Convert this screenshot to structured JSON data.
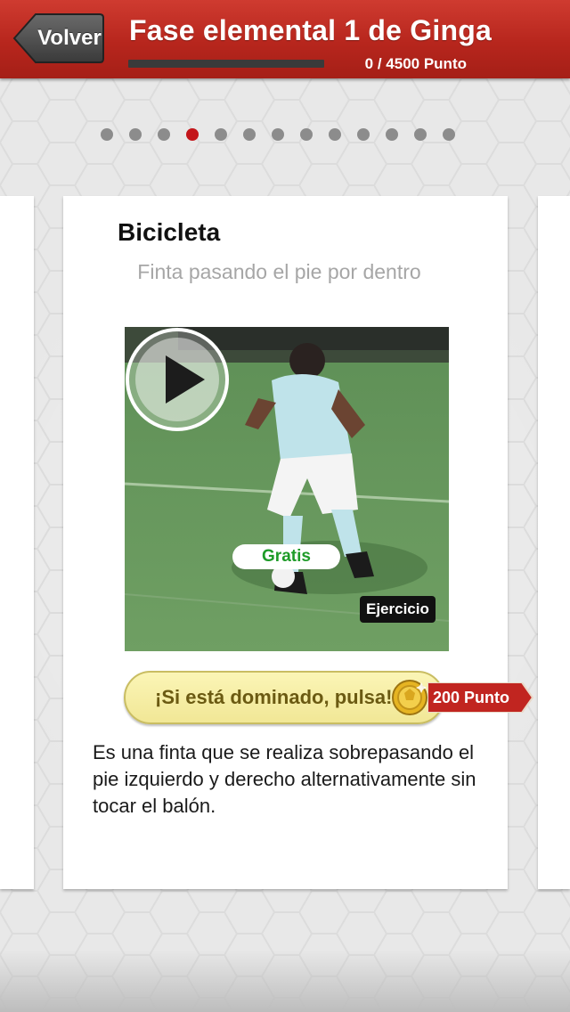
{
  "header": {
    "back_label": "Volver",
    "title": "Fase elemental 1 de Ginga",
    "points_text": "0 /  4500 Punto",
    "progress": 0
  },
  "pager": {
    "count": 13,
    "active_index": 3,
    "active_color": "#c3161a",
    "inactive_color": "#8c8c8c"
  },
  "card": {
    "title": "Bicicleta",
    "subtitle": "Finta pasando el pie por dentro",
    "video": {
      "free_label": "Gratis",
      "exercise_label": "Ejercicio",
      "play_icon": "play-icon"
    },
    "master_button_label": "¡Si está dominado, pulsa!",
    "reward_label": "200 Punto",
    "description": "Es una finta que se realiza sobrepasando el pie izquierdo y derecho alternativamente sin tocar el balón."
  },
  "colors": {
    "header": "#b7261d",
    "accent_green": "#1e9b28",
    "master_button": "#f4eca4",
    "reward_ribbon": "#c12520"
  }
}
